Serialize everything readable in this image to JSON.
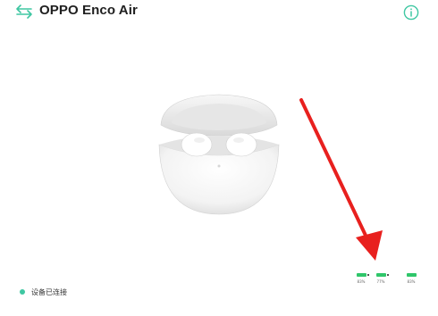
{
  "header": {
    "title": "OPPO Enco Air",
    "back_icon": "swap-arrows-icon",
    "info_icon": "info-icon",
    "accent_color": "#3fc7a2"
  },
  "main": {
    "product_image": "earbuds-charging-case"
  },
  "status": {
    "text": "设备已连接",
    "dot_color": "#3fc7a2"
  },
  "battery": {
    "left": {
      "level": "83%"
    },
    "right": {
      "level": "77%"
    },
    "case": {
      "level": "83%"
    },
    "bar_color": "#2fc66a"
  },
  "annotation": {
    "arrow_color": "#e8201e"
  }
}
